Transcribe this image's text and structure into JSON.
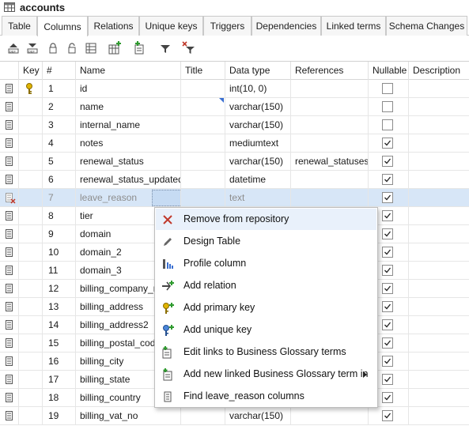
{
  "window": {
    "title": "accounts"
  },
  "tabs": [
    "Table",
    "Columns",
    "Relations",
    "Unique keys",
    "Triggers",
    "Dependencies",
    "Linked terms",
    "Schema Changes"
  ],
  "active_tab": "Columns",
  "toolbar": [
    "import-icon",
    "export-icon",
    "lock-icon",
    "unlock-icon",
    "table-icon",
    "add-column-icon",
    "add-linked-icon",
    "filter-icon",
    "clear-filter-icon"
  ],
  "columns_header": [
    "Key",
    "#",
    "Name",
    "Title",
    "Data type",
    "References",
    "Nullable",
    "Description"
  ],
  "rows": [
    {
      "num": "1",
      "name": "id",
      "type": "int(10, 0)",
      "ref": "",
      "nullable": false,
      "pk": true
    },
    {
      "num": "2",
      "name": "name",
      "type": "varchar(150)",
      "ref": "",
      "nullable": false
    },
    {
      "num": "3",
      "name": "internal_name",
      "type": "varchar(150)",
      "ref": "",
      "nullable": false
    },
    {
      "num": "4",
      "name": "notes",
      "type": "mediumtext",
      "ref": "",
      "nullable": true
    },
    {
      "num": "5",
      "name": "renewal_status",
      "type": "varchar(150)",
      "ref": "renewal_statuses",
      "nullable": true
    },
    {
      "num": "6",
      "name": "renewal_status_updated",
      "type": "datetime",
      "ref": "",
      "nullable": true
    },
    {
      "num": "7",
      "name": "leave_reason",
      "type": "text",
      "ref": "",
      "nullable": true,
      "selected": true
    },
    {
      "num": "8",
      "name": "tier",
      "type": "",
      "ref": "",
      "nullable": true
    },
    {
      "num": "9",
      "name": "domain",
      "type": "",
      "ref": "",
      "nullable": true
    },
    {
      "num": "10",
      "name": "domain_2",
      "type": "",
      "ref": "",
      "nullable": true
    },
    {
      "num": "11",
      "name": "domain_3",
      "type": "",
      "ref": "",
      "nullable": true
    },
    {
      "num": "12",
      "name": "billing_company_na",
      "type": "",
      "ref": "",
      "nullable": true
    },
    {
      "num": "13",
      "name": "billing_address",
      "type": "",
      "ref": "",
      "nullable": true
    },
    {
      "num": "14",
      "name": "billing_address2",
      "type": "",
      "ref": "",
      "nullable": true
    },
    {
      "num": "15",
      "name": "billing_postal_code",
      "type": "",
      "ref": "",
      "nullable": true
    },
    {
      "num": "16",
      "name": "billing_city",
      "type": "",
      "ref": "",
      "nullable": true
    },
    {
      "num": "17",
      "name": "billing_state",
      "type": "",
      "ref": "",
      "nullable": true
    },
    {
      "num": "18",
      "name": "billing_country",
      "type": "",
      "ref": "",
      "nullable": true
    },
    {
      "num": "19",
      "name": "billing_vat_no",
      "type": "varchar(150)",
      "ref": "",
      "nullable": true
    }
  ],
  "context_menu": [
    {
      "label": "Remove from repository",
      "icon": "remove-icon",
      "highlighted": true
    },
    {
      "label": "Design Table",
      "icon": "pencil-icon"
    },
    {
      "label": "Profile column",
      "icon": "profile-icon"
    },
    {
      "label": "Add relation",
      "icon": "relation-icon"
    },
    {
      "label": "Add primary key",
      "icon": "primary-key-icon"
    },
    {
      "label": "Add unique key",
      "icon": "unique-key-icon"
    },
    {
      "label": "Edit links to Business Glossary terms",
      "icon": "glossary-links-icon"
    },
    {
      "label": "Add new linked Business Glossary term in",
      "icon": "glossary-add-icon",
      "submenu": true
    },
    {
      "label": "Find leave_reason columns",
      "icon": "find-columns-icon"
    }
  ],
  "colors": {
    "selection": "#d7e6f7",
    "accent": "#3a6fd1",
    "remove": "#c0392b",
    "key": "#c9a500"
  }
}
